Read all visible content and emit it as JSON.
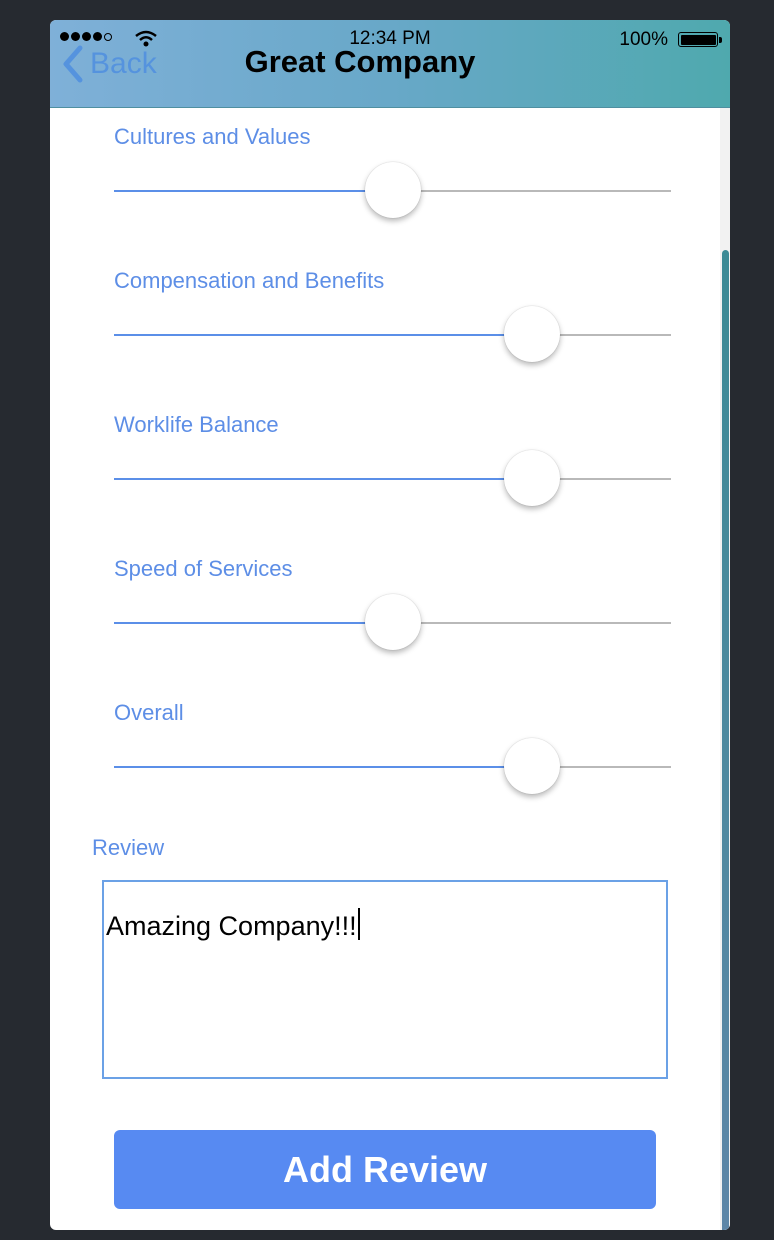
{
  "status_bar": {
    "time": "12:34 PM",
    "battery": "100%"
  },
  "nav": {
    "back_label": "Back",
    "title": "Great Company"
  },
  "sliders": [
    {
      "label": "Cultures and Values",
      "value": 0.5
    },
    {
      "label": "Compensation and Benefits",
      "value": 0.75
    },
    {
      "label": "Worklife Balance",
      "value": 0.75
    },
    {
      "label": "Speed of Services",
      "value": 0.5
    },
    {
      "label": "Overall",
      "value": 0.75
    }
  ],
  "review": {
    "label": "Review",
    "value": "Amazing Company!!!"
  },
  "add_button": {
    "label": "Add Review"
  },
  "colors": {
    "accent": "#578af2",
    "label": "#5d8ee6",
    "track_filled": "#5b8fe8",
    "track_empty": "#b9b9b9"
  }
}
